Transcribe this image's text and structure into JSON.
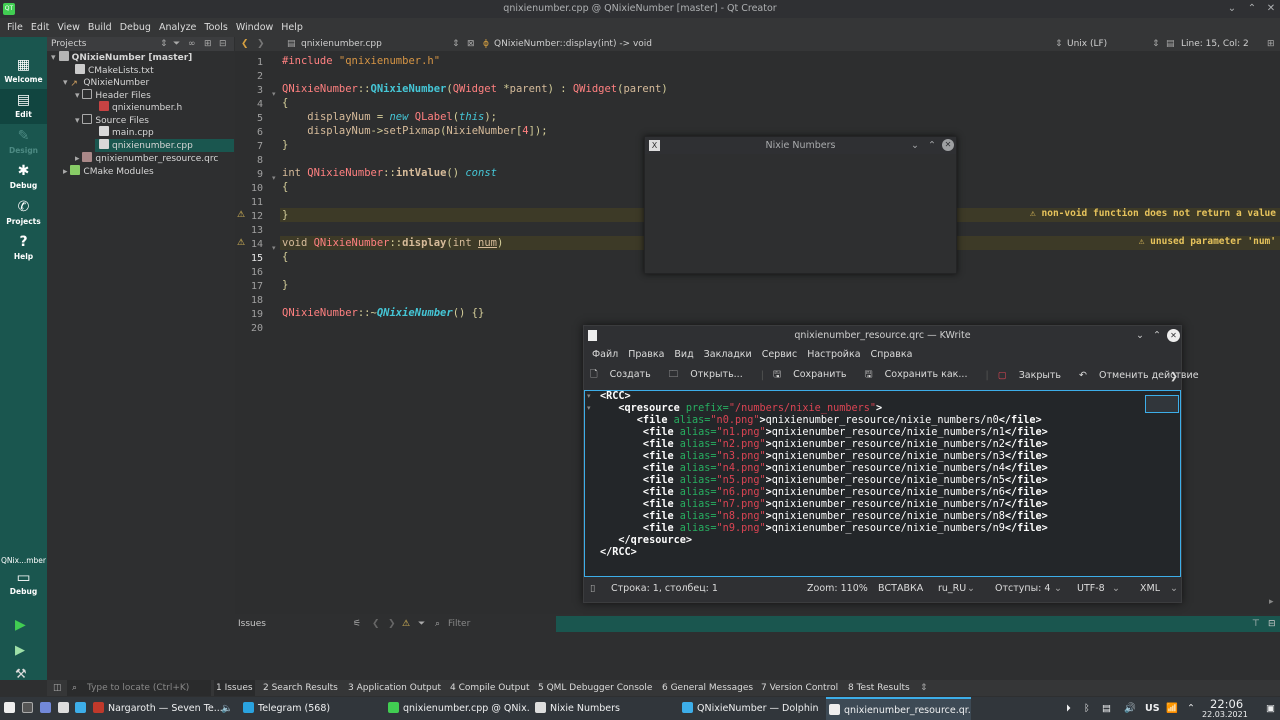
{
  "window": {
    "title": "qnixienumber.cpp @ QNixieNumber [master] - Qt Creator"
  },
  "menu": [
    "File",
    "Edit",
    "View",
    "Build",
    "Debug",
    "Analyze",
    "Tools",
    "Window",
    "Help"
  ],
  "modes": [
    {
      "label": "Welcome",
      "icon": "grid-icon"
    },
    {
      "label": "Edit",
      "icon": "edit-icon"
    },
    {
      "label": "Design",
      "icon": "pen-icon"
    },
    {
      "label": "Debug",
      "icon": "bug-icon"
    },
    {
      "label": "Projects",
      "icon": "wrench-icon"
    },
    {
      "label": "Help",
      "icon": "help-icon"
    }
  ],
  "kit": {
    "name": "QNix...mber",
    "mode": "Debug"
  },
  "projects": {
    "header": "Projects",
    "tree": [
      {
        "label": "QNixieNumber [master]",
        "level": 0
      },
      {
        "label": "CMakeLists.txt",
        "level": 1
      },
      {
        "label": "QNixieNumber",
        "level": 1
      },
      {
        "label": "Header Files",
        "level": 2
      },
      {
        "label": "qnixienumber.h",
        "level": 3
      },
      {
        "label": "Source Files",
        "level": 2
      },
      {
        "label": "main.cpp",
        "level": 3
      },
      {
        "label": "qnixienumber.cpp",
        "level": 3
      },
      {
        "label": "qnixienumber_resource.qrc",
        "level": 2
      },
      {
        "label": "CMake Modules",
        "level": 1
      }
    ]
  },
  "editor": {
    "file": "qnixienumber.cpp",
    "symbol": "QNixieNumber::display(int) -> void",
    "line_ending": "Unix (LF)",
    "position": "Line: 15, Col: 2",
    "line_numbers": [
      "1",
      "2",
      "3",
      "4",
      "5",
      "6",
      "7",
      "8",
      "9",
      "10",
      "11",
      "12",
      "13",
      "14",
      "15",
      "16",
      "17",
      "18",
      "19",
      "20"
    ],
    "warnings": [
      "non-void function does not return a value",
      "unused parameter 'num'"
    ]
  },
  "nixie_window": {
    "title": "Nixie Numbers"
  },
  "kwrite": {
    "title": "qnixienumber_resource.qrc — KWrite",
    "menu": [
      "Файл",
      "Правка",
      "Вид",
      "Закладки",
      "Сервис",
      "Настройка",
      "Справка"
    ],
    "toolbar": [
      "Создать",
      "Открыть...",
      "Сохранить",
      "Сохранить как...",
      "Закрыть",
      "Отменить действие"
    ],
    "status": {
      "cursor": "Строка: 1, столбец: 1",
      "zoom": "Zoom: 110%",
      "mode": "ВСТАВКА",
      "language": "ru_RU",
      "indent": "Отступы: 4",
      "encoding": "UTF-8",
      "syntax": "XML"
    }
  },
  "issues": {
    "title": "Issues",
    "filter_placeholder": "Filter"
  },
  "bottom": {
    "locator_placeholder": "Type to locate (Ctrl+K)",
    "tabs": [
      "1  Issues",
      "2  Search Results",
      "3  Application Output",
      "4  Compile Output",
      "5  QML Debugger Console",
      "6  General Messages",
      "7  Version Control",
      "8  Test Results"
    ]
  },
  "taskbar": {
    "tasks": [
      "Nargaroth — Seven Te...",
      "Telegram (568)",
      "qnixienumber.cpp @ QNix...",
      "Nixie Numbers",
      "QNixieNumber — Dolphin",
      "qnixienumber_resource.qr..."
    ],
    "layout": "US",
    "time": "22:06",
    "date": "22.03.2021"
  }
}
